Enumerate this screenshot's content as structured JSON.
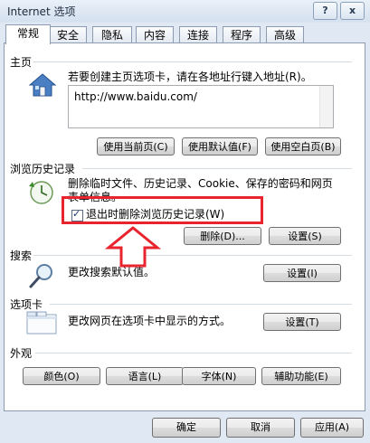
{
  "window": {
    "title": "Internet 选项",
    "help_glyph": "?",
    "close_glyph": "x"
  },
  "tabs": [
    "常规",
    "安全",
    "隐私",
    "内容",
    "连接",
    "程序",
    "高级"
  ],
  "home": {
    "group_label": "主页",
    "instruction": "若要创建主页选项卡，请在各地址行键入地址(R)。",
    "url": "http://www.baidu.com/",
    "btn_current": "使用当前页(C)",
    "btn_default": "使用默认值(F)",
    "btn_blank": "使用空白页(B)"
  },
  "history": {
    "group_label": "浏览历史记录",
    "description": "删除临时文件、历史记录、Cookie、保存的密码和网页表单信息。",
    "checkbox_label": "退出时删除浏览历史记录(W)",
    "checkbox_checked": true,
    "btn_delete": "删除(D)...",
    "btn_settings": "设置(S)"
  },
  "search": {
    "group_label": "搜索",
    "description": "更改搜索默认值。",
    "btn_settings": "设置(I)"
  },
  "tabs_group": {
    "group_label": "选项卡",
    "description": "更改网页在选项卡中显示的方式。",
    "btn_settings": "设置(T)"
  },
  "appearance": {
    "group_label": "外观",
    "btn_colors": "颜色(O)",
    "btn_languages": "语言(L)",
    "btn_fonts": "字体(N)",
    "btn_accessibility": "辅助功能(E)"
  },
  "footer": {
    "btn_ok": "确定",
    "btn_cancel": "取消",
    "btn_apply": "应用(A)"
  },
  "annotation": {
    "highlight_color": "#e8242f"
  }
}
